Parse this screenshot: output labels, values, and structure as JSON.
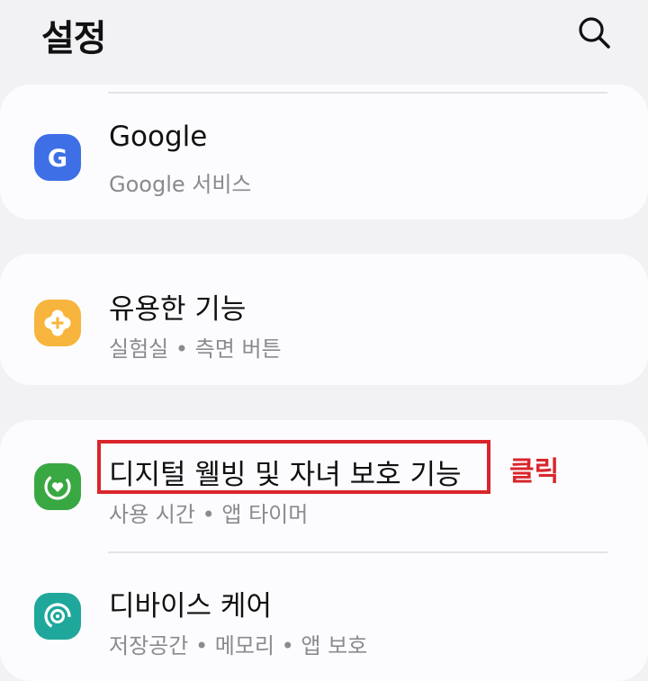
{
  "header": {
    "title": "설정"
  },
  "icons": {
    "search": "search-icon",
    "google": "google-icon",
    "useful": "useful-features-icon",
    "digital": "digital-wellbeing-icon",
    "device": "device-care-icon"
  },
  "colors": {
    "google": "#3f6fe6",
    "useful": "#f7b53d",
    "digital": "#3aa842",
    "device": "#1fa79b",
    "highlight": "#d9262c"
  },
  "items": [
    {
      "title": "Google",
      "subtitle": "Google 서비스"
    },
    {
      "title": "유용한 기능",
      "subtitle": "실험실  •  측면 버튼"
    },
    {
      "title": "디지털 웰빙 및 자녀 보호 기능",
      "subtitle": "사용 시간  •  앱 타이머"
    },
    {
      "title": "디바이스 케어",
      "subtitle": "저장공간  •  메모리  •  앱 보호"
    }
  ],
  "annotation": {
    "text": "클릭"
  }
}
